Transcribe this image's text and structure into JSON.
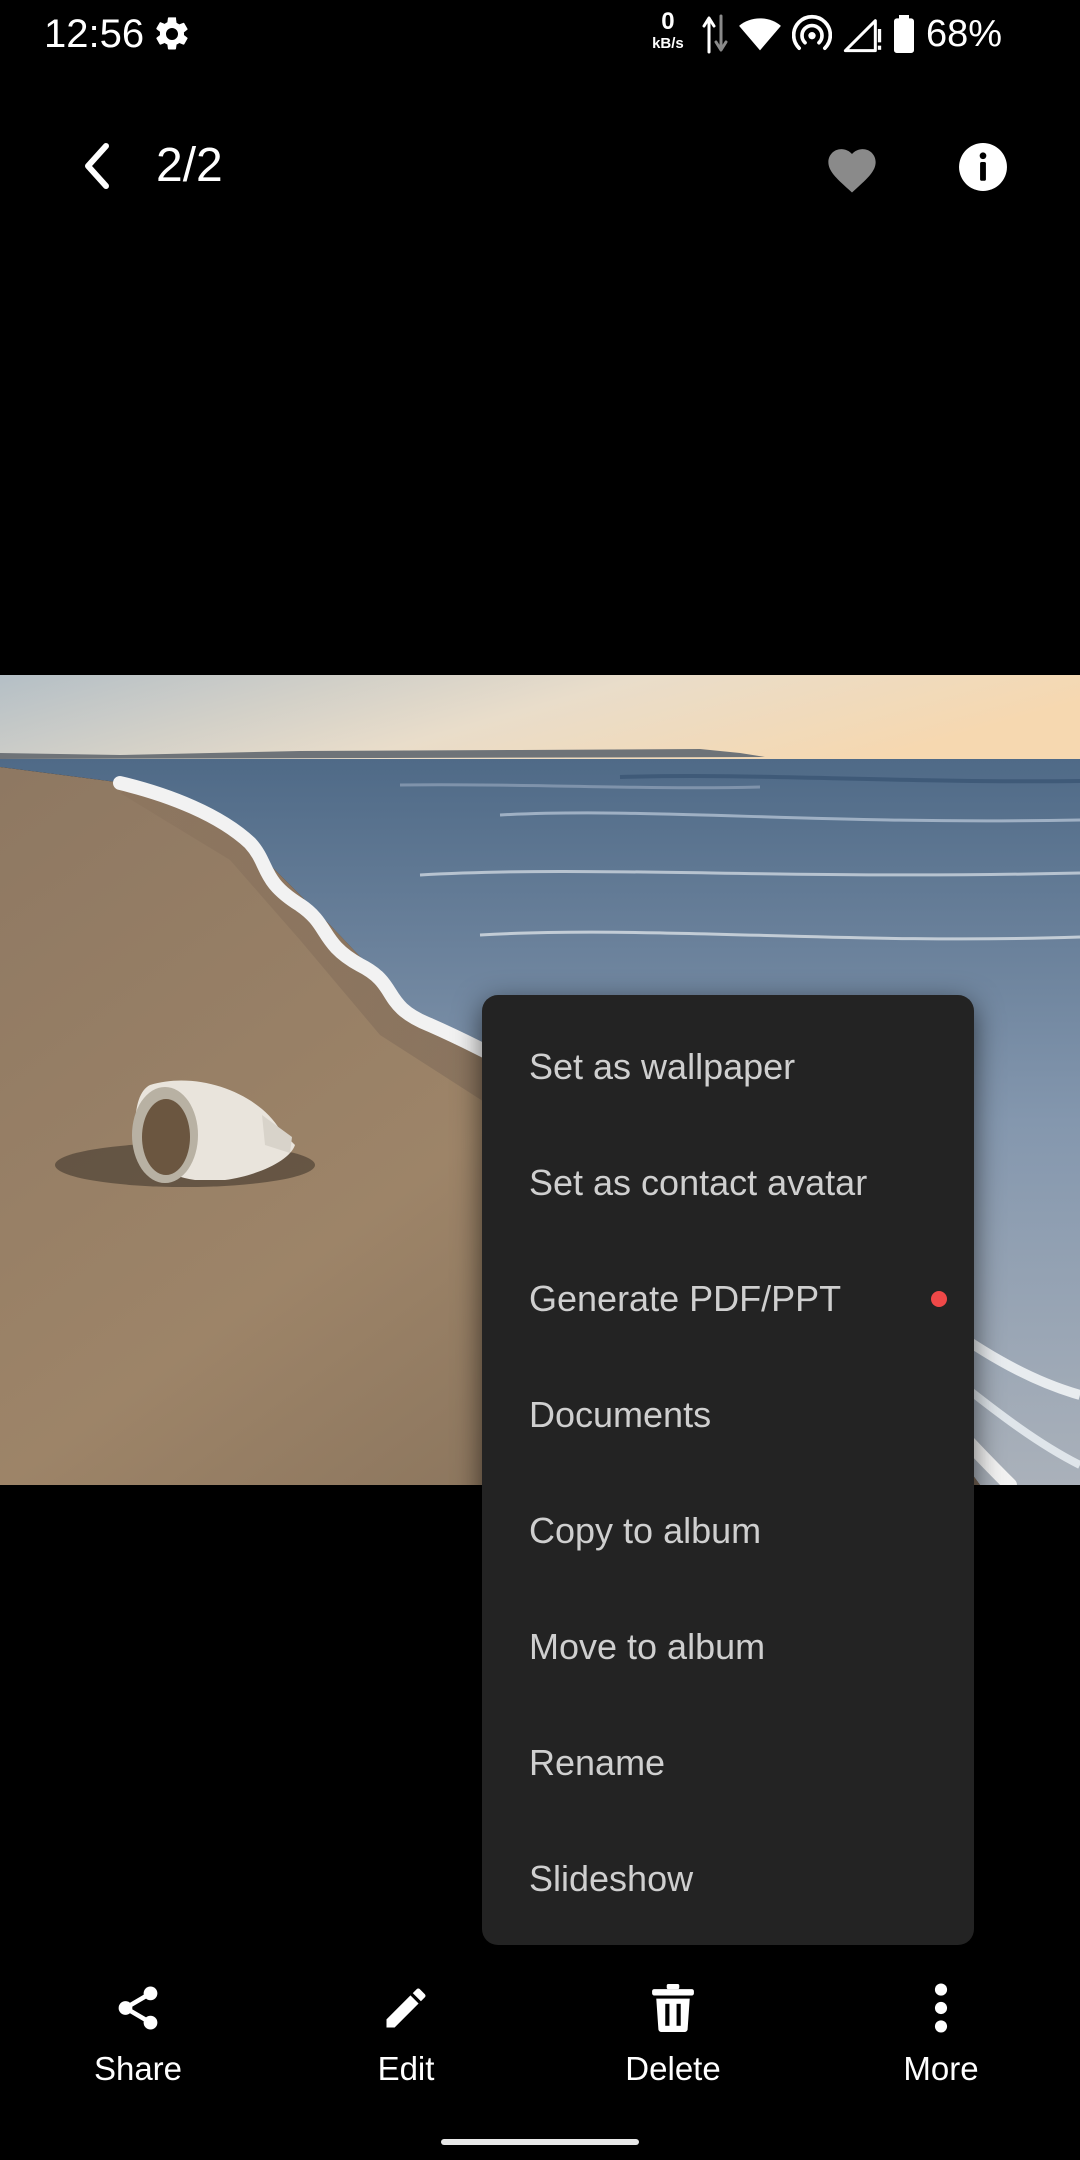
{
  "status_bar": {
    "time": "12:56",
    "net_speed_value": "0",
    "net_speed_unit": "kB/s",
    "battery_percent": "68%",
    "icons": [
      "settings-gear-icon",
      "data-arrows-icon",
      "wifi-icon",
      "hotspot-icon",
      "cell-signal-icon",
      "battery-icon"
    ]
  },
  "top_bar": {
    "back_icon": "chevron-left-icon",
    "page_counter": "2/2",
    "favorite_icon": "heart-icon",
    "info_icon": "info-icon"
  },
  "photo": {
    "subject": "beach-photo"
  },
  "popup_menu": {
    "items": [
      {
        "label": "Set as wallpaper"
      },
      {
        "label": "Set as contact avatar"
      },
      {
        "label": "Generate PDF/PPT",
        "badge": "new-dot",
        "badge_color": "#ef4848"
      },
      {
        "label": "Documents"
      },
      {
        "label": "Copy to album"
      },
      {
        "label": "Move to album"
      },
      {
        "label": "Rename"
      },
      {
        "label": "Slideshow"
      }
    ]
  },
  "bottom_bar": {
    "actions": [
      {
        "label": "Share",
        "icon": "share-icon"
      },
      {
        "label": "Edit",
        "icon": "pencil-icon"
      },
      {
        "label": "Delete",
        "icon": "trash-icon"
      },
      {
        "label": "More",
        "icon": "more-vertical-icon"
      }
    ]
  },
  "colors": {
    "background": "#000000",
    "menu_background": "#232323",
    "menu_text": "#cfcfcf",
    "accent_dot": "#ef4848",
    "heart": "#8a8a8a"
  }
}
